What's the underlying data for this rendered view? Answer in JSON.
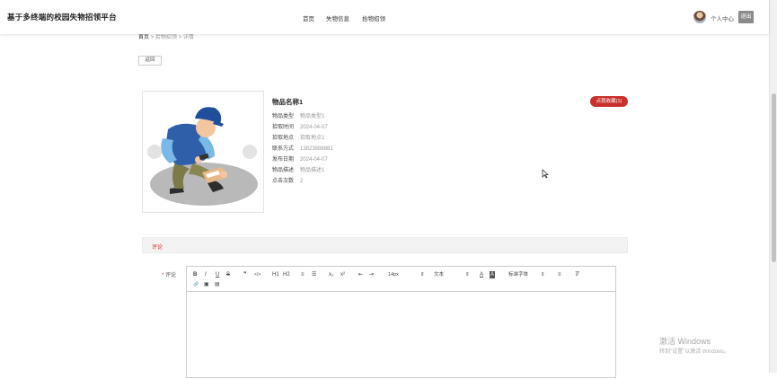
{
  "header": {
    "brand": "基于多终端的校园失物招领平台",
    "nav": {
      "home": "首页",
      "lost": "失物信息",
      "found": "拾物招领"
    },
    "user_center": "个人中心",
    "logout": "退出"
  },
  "breadcrumb": {
    "home": "首页",
    "sep1": ">",
    "section": "拾物招领",
    "sep2": ">",
    "current": "详情"
  },
  "back_label": "返回",
  "item": {
    "title": "物品名称1",
    "favorite_label": "点我收藏(1)",
    "fields": [
      {
        "label": "物品类型",
        "value": "物品类型1"
      },
      {
        "label": "拾取时间",
        "value": "2024-04-07"
      },
      {
        "label": "拾取地点",
        "value": "拾取地点1"
      },
      {
        "label": "联系方式",
        "value": "13823888881"
      },
      {
        "label": "发布日期",
        "value": "2024-04-07"
      },
      {
        "label": "物品描述",
        "value": "物品描述1"
      },
      {
        "label": "点击次数",
        "value": "2"
      }
    ]
  },
  "comment": {
    "section_title": "评论",
    "required_mark": "*",
    "field_label": "评论",
    "toolbar": {
      "bold": "B",
      "italic": "I",
      "underline": "U",
      "strike": "S",
      "quote": "❞",
      "code": "</>",
      "h1": "H1",
      "h2": "H2",
      "ordered_list": "≡",
      "bullet_list": "☰",
      "subscript": "x₂",
      "superscript": "x²",
      "outdent": "⇤",
      "indent": "⇥",
      "font_size": "14px",
      "heading": "文本",
      "font_family": "标准字体",
      "color": "A",
      "bg_color": "A",
      "align": "≡",
      "clear": "T̸",
      "link": "🔗",
      "image": "▣",
      "video": "▤"
    }
  },
  "watermark": {
    "line1": "激活 Windows",
    "line2": "转到\"设置\"以激活 Windows。"
  },
  "colors": {
    "accent": "#c9302c",
    "header_bg": "#ffffff",
    "logout_bg": "#8a8a8a"
  }
}
